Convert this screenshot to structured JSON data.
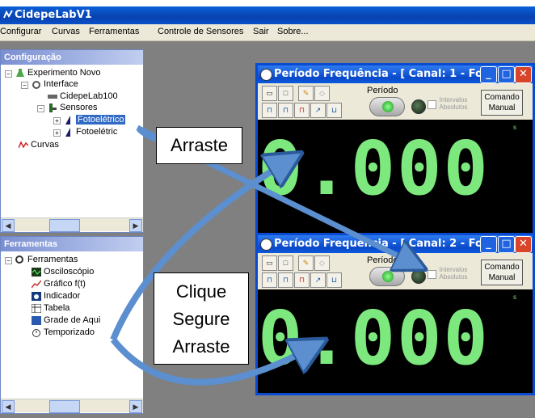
{
  "app": {
    "title": "CidepeLabV1"
  },
  "menu": [
    "Configurar",
    "Curvas",
    "Ferramentas",
    "Controle de Sensores",
    "Sair",
    "Sobre..."
  ],
  "config_panel": {
    "title": "Configuração",
    "tree": {
      "root": "Experimento Novo",
      "interface": "Interface",
      "device": "CidepeLab100",
      "sensors": "Sensores",
      "sensor1": "Fotoelétrico",
      "sensor2": "Fotoelétric",
      "curves": "Curvas"
    }
  },
  "tools_panel": {
    "title": "Ferramentas",
    "tree": {
      "root": "Ferramentas",
      "oscilloscope": "Osciloscópio",
      "graph": "Gráfico f(t)",
      "indicator": "Indicador",
      "table": "Tabela",
      "grid": "Grade de Aqui",
      "timer": "Temporizado"
    }
  },
  "windows": [
    {
      "title": "Período Frequência - [ Canal: 1 - Fo...",
      "mode_label": "Período",
      "intervals_label": "Intervalos Absolutos",
      "command_label": "Comando Manual",
      "value": "0.000",
      "unit": "s"
    },
    {
      "title": "Período Frequência - [ Canal: 2 - Fo...",
      "mode_label": "Período",
      "intervals_label": "Intervalos Absolutos",
      "command_label": "Comando Manual",
      "value": "0.000",
      "unit": "s"
    }
  ],
  "callouts": {
    "drag": "Arraste",
    "click_hold_drag": [
      "Clique",
      "Segure",
      "Arraste"
    ]
  },
  "colors": {
    "display_digits": "#7de87d",
    "title_blue": "#0a49c8",
    "arrow_fill": "#5b8fd0"
  }
}
